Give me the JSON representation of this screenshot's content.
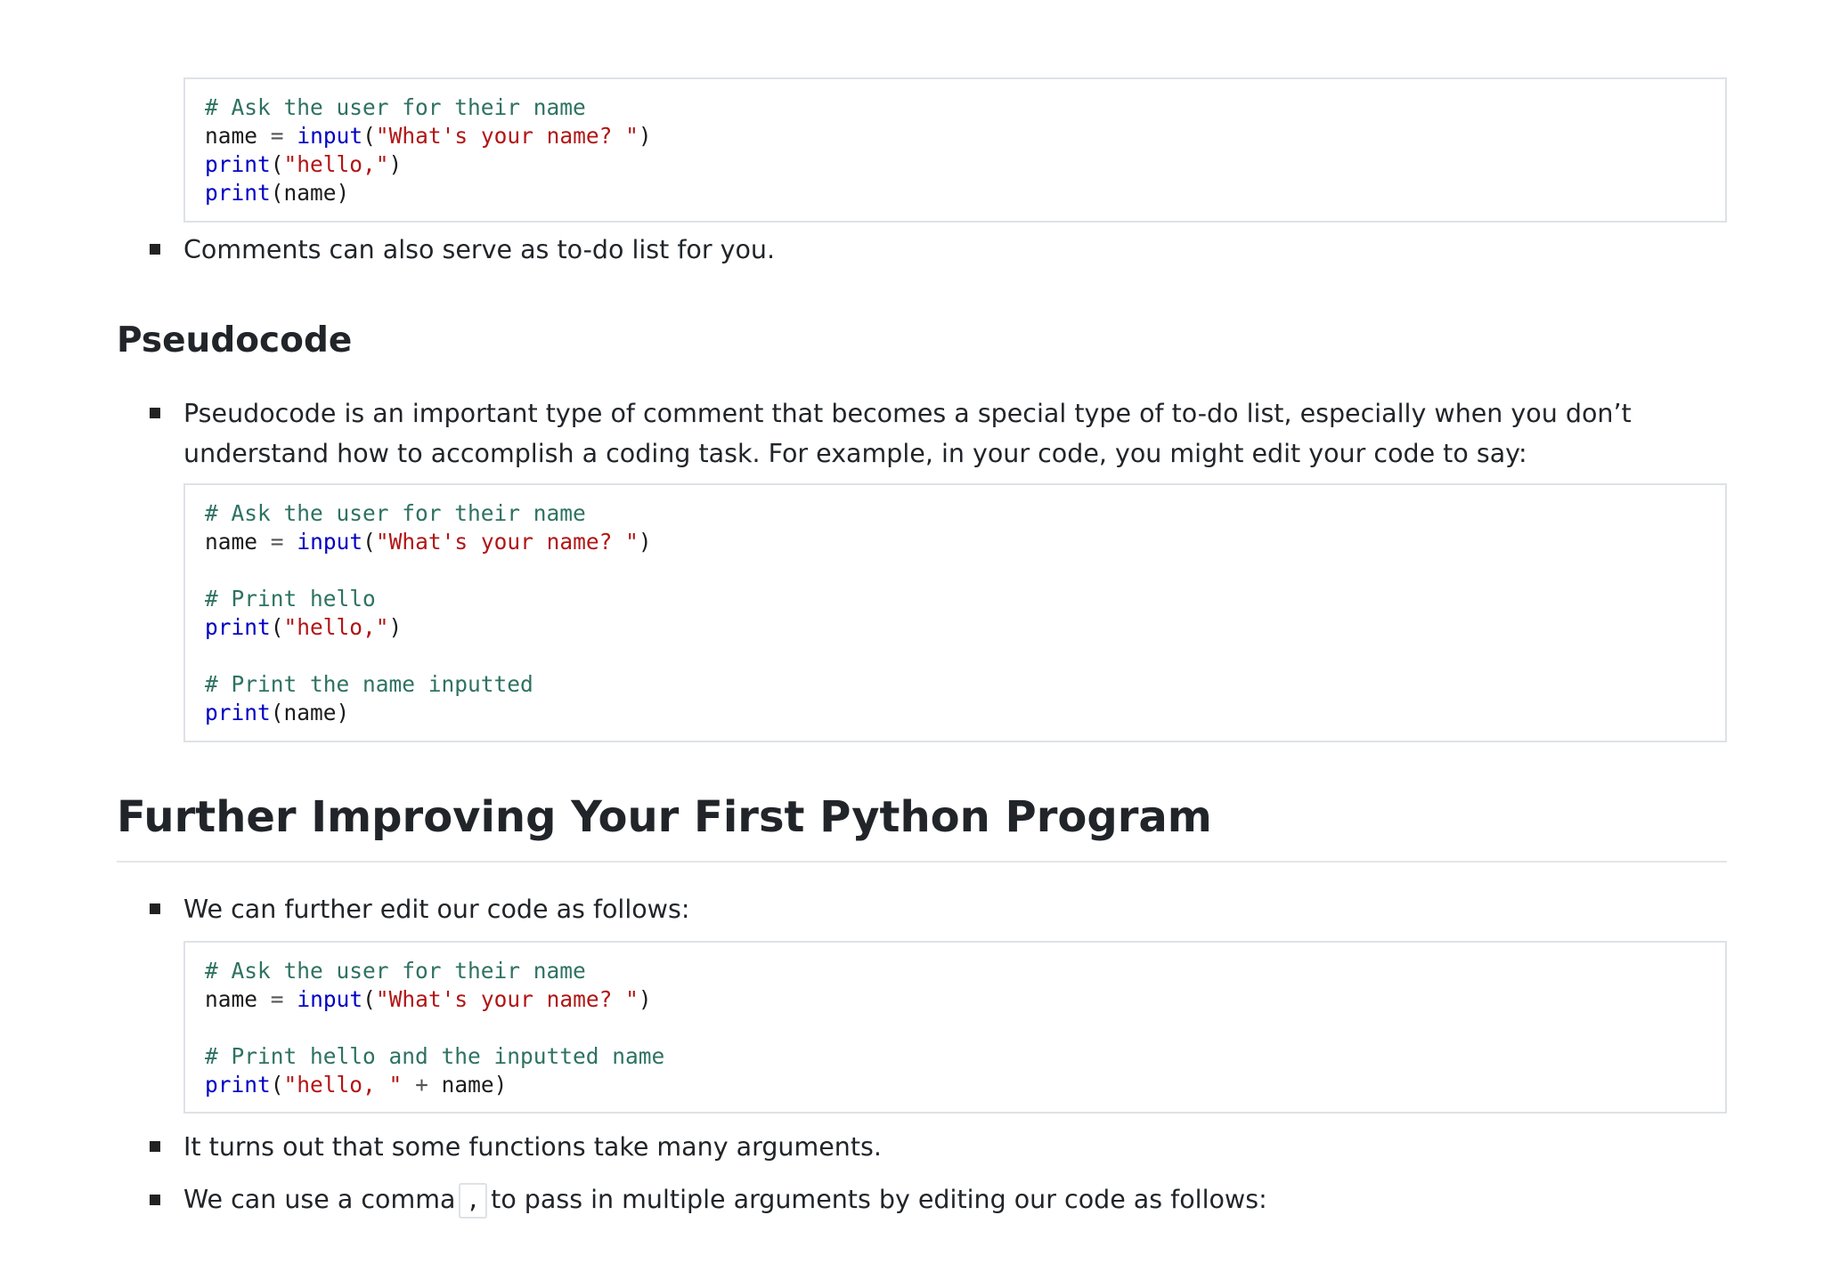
{
  "blocks": {
    "code1": {
      "comment_ask": "# Ask the user for their name",
      "var_name": "name",
      "equals": "=",
      "fn_input": "input",
      "str_prompt": "\"What's your name? \"",
      "fn_print": "print",
      "str_hello": "\"hello,\"",
      "arg_name": "name"
    },
    "bullet_comments": "Comments can also serve as to-do list for you.",
    "heading_pseudocode": "Pseudocode",
    "bullet_pseudocode": "Pseudocode is an important type of comment that becomes a special type of to-do list, especially when you don’t understand how to accomplish a coding task. For example, in your code, you might edit your code to say:",
    "code2": {
      "comment_ask": "# Ask the user for their name",
      "comment_print_hello": "# Print hello",
      "comment_print_name": "# Print the name inputted"
    },
    "heading_further": "Further Improving Your First Python Program",
    "bullet_further": "We can further edit our code as follows:",
    "code3": {
      "comment_ask": "# Ask the user for their name",
      "comment_print_both": "# Print hello and the inputted name",
      "str_hello_space": "\"hello, \"",
      "plus": "+"
    },
    "bullet_functions": "It turns out that some functions take many arguments.",
    "bullet_comma_before": "We can use a comma",
    "inline_comma": ",",
    "bullet_comma_after": "to pass in multiple arguments by editing our code as follows:"
  }
}
